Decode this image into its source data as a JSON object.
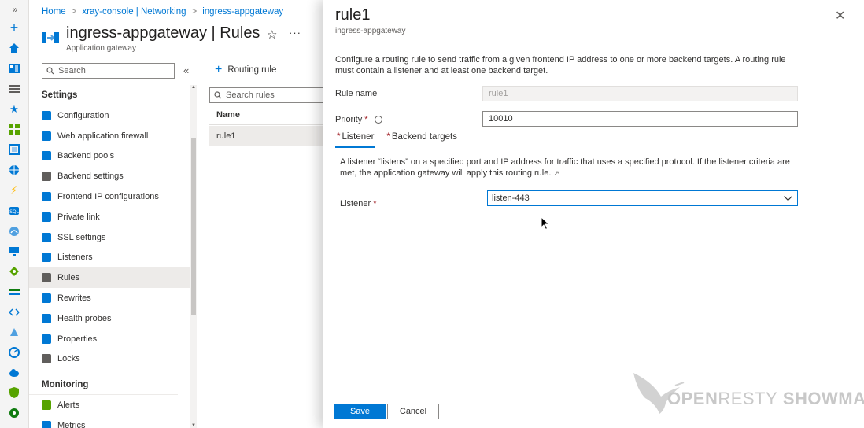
{
  "rail": {
    "expand_glyph": "»",
    "icons": [
      "plus-icon",
      "home-icon",
      "dashboard-icon",
      "all-services-icon",
      "favorites-icon",
      "grid-icon",
      "resource-icon",
      "globe-icon",
      "lightning-icon",
      "sql-icon",
      "network-icon",
      "monitor-icon",
      "diamond-icon",
      "list-icon",
      "cloud-arrows-icon",
      "shape-icon",
      "gauge-icon",
      "cloud-icon",
      "shield-icon",
      "advisor-icon"
    ]
  },
  "breadcrumb": {
    "items": [
      "Home",
      "xray-console | Networking",
      "ingress-appgateway"
    ],
    "separator": ">"
  },
  "resource": {
    "title": "ingress-appgateway | Rules",
    "subtitle": "Application gateway",
    "star_glyph": "☆",
    "more_glyph": "···"
  },
  "nav": {
    "search_placeholder": "Search",
    "collapse_glyph": "«",
    "settings_group": "Settings",
    "settings_items": [
      {
        "label": "Configuration",
        "color": "#0078d4"
      },
      {
        "label": "Web application firewall",
        "color": "#0078d4"
      },
      {
        "label": "Backend pools",
        "color": "#0078d4"
      },
      {
        "label": "Backend settings",
        "color": "#605e5c"
      },
      {
        "label": "Frontend IP configurations",
        "color": "#0078d4"
      },
      {
        "label": "Private link",
        "color": "#0078d4"
      },
      {
        "label": "SSL settings",
        "color": "#0078d4"
      },
      {
        "label": "Listeners",
        "color": "#0078d4"
      },
      {
        "label": "Rules",
        "color": "#605e5c"
      },
      {
        "label": "Rewrites",
        "color": "#0078d4"
      },
      {
        "label": "Health probes",
        "color": "#0078d4"
      },
      {
        "label": "Properties",
        "color": "#0078d4"
      },
      {
        "label": "Locks",
        "color": "#605e5c"
      }
    ],
    "monitoring_group": "Monitoring",
    "monitoring_items": [
      {
        "label": "Alerts",
        "color": "#57a300"
      },
      {
        "label": "Metrics",
        "color": "#0078d4"
      }
    ]
  },
  "rules_list": {
    "add_label": "Routing rule",
    "search_placeholder": "Search rules",
    "column_name": "Name",
    "rows": [
      "rule1"
    ]
  },
  "pane": {
    "title": "rule1",
    "subtitle": "ingress-appgateway",
    "description": "Configure a routing rule to send traffic from a given frontend IP address to one or more backend targets. A routing rule must contain a listener and at least one backend target.",
    "rule_name_label": "Rule name",
    "rule_name_value": "rule1",
    "priority_label": "Priority",
    "required_mark": "*",
    "priority_value": "10010",
    "tabs": [
      "Listener",
      "Backend targets"
    ],
    "listener_description": "A listener “listens” on a specified port and IP address for traffic that uses a specified protocol. If the listener criteria are met, the application gateway will apply this routing rule.",
    "listener_label": "Listener",
    "listener_value": "listen-443",
    "save_label": "Save",
    "cancel_label": "Cancel"
  },
  "watermark": {
    "text_a": "OPEN",
    "text_b": "RESTY",
    "text_c": "SHOWMAN"
  },
  "colors": {
    "accent": "#0078d4",
    "required": "#a4262c"
  }
}
